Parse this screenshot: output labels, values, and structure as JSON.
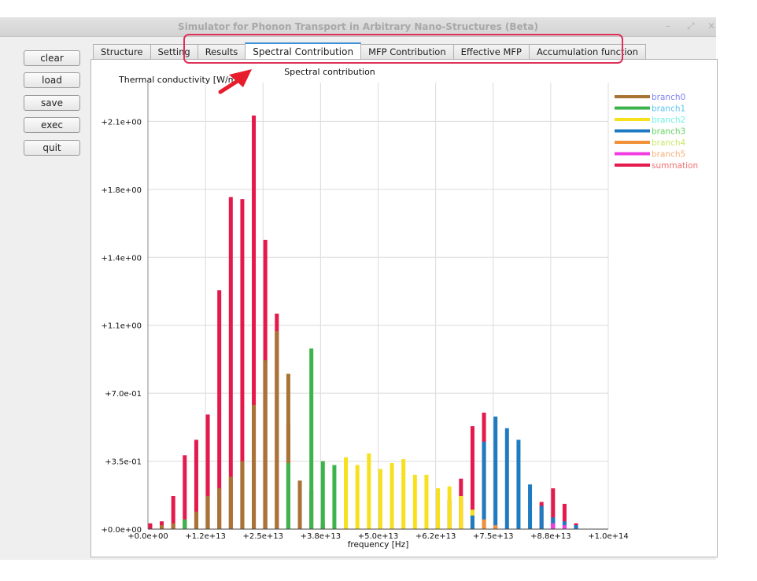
{
  "window": {
    "title": "Simulator for Phonon Transport in Arbitrary Nano-Structures (Beta)",
    "controls": [
      "–",
      "⤢",
      "✕"
    ]
  },
  "sidebar": {
    "buttons": [
      "clear",
      "load",
      "save",
      "exec",
      "quit"
    ]
  },
  "tabs": {
    "items": [
      "Structure",
      "Setting",
      "Results",
      "Spectral Contribution",
      "MFP Contribution",
      "Effective MFP",
      "Accumulation function"
    ],
    "active": "Spectral Contribution"
  },
  "colors": {
    "branch0": "#a87335",
    "branch1": "#3cb44b",
    "branch2": "#f7e01e",
    "branch3": "#1f7bc1",
    "branch4": "#f0913a",
    "branch5": "#f03ce0",
    "summation": "#e4194c",
    "legend_text": [
      "#7f7ff5",
      "#5fc4f0",
      "#6ef5e0",
      "#5fd45f",
      "#c9e86a",
      "#f5b17a",
      "#f07070"
    ]
  },
  "chart_data": {
    "type": "bar",
    "title": "Spectral contribution",
    "ylabel": "Thermal conductivity [W/m",
    "xlabel": "frequency [Hz]",
    "xlim": [
      0,
      100000000000000.0
    ],
    "ylim": [
      0,
      2.3
    ],
    "x_ticks": [
      0,
      12500000000000.0,
      25000000000000.0,
      37500000000000.0,
      50000000000000.0,
      62500000000000.0,
      75000000000000.0,
      87500000000000.0,
      100000000000000.0
    ],
    "x_tick_labels": [
      "+0.0e+00",
      "+1.2e+13",
      "+2.5e+13",
      "+3.8e+13",
      "+5.0e+13",
      "+6.2e+13",
      "+7.5e+13",
      "+8.8e+13",
      "+1.0e+14"
    ],
    "y_ticks": [
      0,
      0.35,
      0.7,
      1.05,
      1.4,
      1.75,
      2.1
    ],
    "y_tick_labels": [
      "+0.0e+00",
      "+3.5e-01",
      "+7.0e-01",
      "+1.1e+00",
      "+1.4e+00",
      "+1.8e+00",
      "+2.1e+00"
    ],
    "grid": true,
    "legend_position": "right",
    "legend": [
      "branch0",
      "branch1",
      "branch2",
      "branch3",
      "branch4",
      "branch5",
      "summation"
    ],
    "x": [
      500000000000.0,
      3000000000000.0,
      5500000000000.0,
      8000000000000.0,
      10500000000000.0,
      13000000000000.0,
      15500000000000.0,
      18000000000000.0,
      20500000000000.0,
      23000000000000.0,
      25500000000000.0,
      28000000000000.0,
      30500000000000.0,
      33000000000000.0,
      35500000000000.0,
      38000000000000.0,
      40500000000000.0,
      43000000000000.0,
      45500000000000.0,
      48000000000000.0,
      50500000000000.0,
      53000000000000.0,
      55500000000000.0,
      58000000000000.0,
      60500000000000.0,
      63000000000000.0,
      65500000000000.0,
      68000000000000.0,
      70500000000000.0,
      73000000000000.0,
      75500000000000.0,
      78000000000000.0,
      80500000000000.0,
      83000000000000.0,
      85500000000000.0,
      88000000000000.0,
      90500000000000.0,
      93000000000000.0,
      95500000000000.0
    ],
    "series": [
      {
        "name": "branch0",
        "values": [
          0,
          0.02,
          0.03,
          0.05,
          0.09,
          0.17,
          0.21,
          0.27,
          0.35,
          0.64,
          0.87,
          1.02,
          0.8,
          0.25,
          0.2,
          0.03,
          0,
          0,
          0,
          0,
          0,
          0,
          0,
          0,
          0,
          0,
          0,
          0,
          0,
          0,
          0,
          0,
          0,
          0,
          0,
          0,
          0,
          0,
          0
        ]
      },
      {
        "name": "branch1",
        "values": [
          0,
          0,
          0,
          0.05,
          0,
          0,
          0,
          0,
          0,
          0,
          0,
          0,
          0.34,
          0,
          0.93,
          0.35,
          0.33,
          0,
          0,
          0,
          0,
          0,
          0,
          0,
          0,
          0,
          0,
          0,
          0,
          0,
          0,
          0,
          0,
          0,
          0,
          0,
          0,
          0,
          0
        ]
      },
      {
        "name": "branch2",
        "values": [
          0,
          0,
          0,
          0,
          0,
          0,
          0,
          0,
          0,
          0,
          0,
          0,
          0,
          0,
          0,
          0,
          0,
          0.37,
          0.33,
          0.39,
          0.31,
          0.34,
          0.36,
          0.28,
          0.28,
          0.21,
          0.22,
          0.17,
          0.1,
          0.02,
          0,
          0,
          0,
          0,
          0,
          0,
          0,
          0,
          0
        ]
      },
      {
        "name": "branch3",
        "values": [
          0,
          0,
          0,
          0,
          0,
          0,
          0,
          0,
          0,
          0,
          0,
          0,
          0,
          0,
          0,
          0,
          0,
          0,
          0,
          0,
          0,
          0,
          0,
          0,
          0,
          0,
          0,
          0,
          0.07,
          0.45,
          0.58,
          0.52,
          0.46,
          0.23,
          0.12,
          0.06,
          0.04,
          0.02,
          0
        ]
      },
      {
        "name": "branch4",
        "values": [
          0,
          0,
          0,
          0,
          0,
          0,
          0,
          0,
          0,
          0,
          0,
          0,
          0,
          0,
          0,
          0,
          0,
          0,
          0,
          0,
          0,
          0,
          0,
          0,
          0,
          0,
          0,
          0,
          0,
          0.05,
          0.02,
          0,
          0,
          0,
          0,
          0.02,
          0.02,
          0,
          0
        ]
      },
      {
        "name": "branch5",
        "values": [
          0,
          0,
          0,
          0,
          0,
          0,
          0,
          0,
          0,
          0,
          0,
          0,
          0,
          0,
          0,
          0,
          0,
          0,
          0,
          0,
          0,
          0,
          0,
          0,
          0,
          0,
          0,
          0,
          0,
          0,
          0,
          0,
          0,
          0,
          0,
          0.03,
          0.02,
          0,
          0
        ]
      },
      {
        "name": "summation",
        "values": [
          0.03,
          0.04,
          0.17,
          0.38,
          0.46,
          0.59,
          1.23,
          1.71,
          1.7,
          2.13,
          1.49,
          1.11,
          0.54,
          0,
          0,
          0,
          0,
          0,
          0,
          0,
          0,
          0,
          0,
          0,
          0,
          0.02,
          0.15,
          0.26,
          0.53,
          0.6,
          0,
          0,
          0,
          0,
          0.14,
          0.21,
          0.13,
          0.03,
          0
        ]
      }
    ]
  }
}
